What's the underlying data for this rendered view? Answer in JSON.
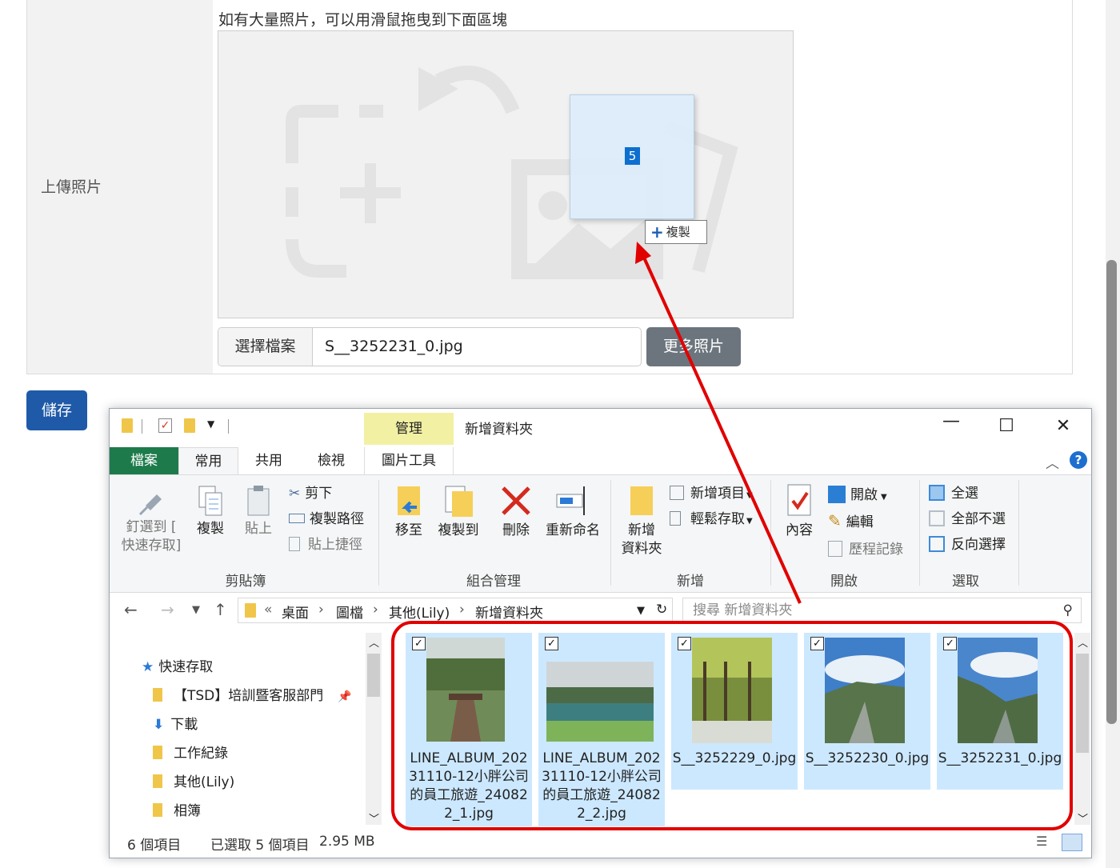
{
  "form": {
    "upload_label": "上傳照片",
    "hint": "如有大量照片，可以用滑鼠拖曳到下面區塊",
    "drag": {
      "count": "5",
      "copy_label": "複製"
    },
    "choose_button": "選擇檔案",
    "file_name": "S__3252231_0.jpg",
    "more_photos_button": "更多照片",
    "save_button": "儲存"
  },
  "explorer": {
    "window_title": "新增資料夾",
    "manage_tab": "管理",
    "tabs": [
      "檔案",
      "常用",
      "共用",
      "檢視",
      "圖片工具"
    ],
    "ribbon": {
      "clipboard": {
        "label": "剪貼簿",
        "pin": "釘選到 [快速存取]",
        "pin_line1": "釘選到 [",
        "pin_line2": "快速存取]",
        "copy": "複製",
        "paste": "貼上",
        "cut": "剪下",
        "copy_path": "複製路徑",
        "paste_shortcut": "貼上捷徑"
      },
      "organize": {
        "label": "組合管理",
        "move_to": "移至",
        "copy_to": "複製到",
        "delete": "刪除",
        "rename": "重新命名"
      },
      "new": {
        "label": "新增",
        "new_folder": "新增資料夾",
        "new_folder_line1": "新增",
        "new_folder_line2": "資料夾",
        "new_item": "新增項目",
        "easy_access": "輕鬆存取"
      },
      "open": {
        "label": "開啟",
        "properties": "內容",
        "open": "開啟",
        "edit": "編輯",
        "history": "歷程記錄"
      },
      "select": {
        "label": "選取",
        "select_all": "全選",
        "select_none": "全部不選",
        "invert": "反向選擇"
      }
    },
    "breadcrumb": {
      "prefix": "«",
      "parts": [
        "桌面",
        "圖檔",
        "其他(Lily)",
        "新增資料夾"
      ]
    },
    "search_placeholder": "搜尋 新增資料夾",
    "nav_pane": {
      "quick_access": "快速存取",
      "items": [
        "【TSD】培訓暨客服部門",
        "下載",
        "工作紀錄",
        "其他(Lily)",
        "相簿"
      ]
    },
    "files": [
      {
        "name": "LINE_ALBUM_20231110-12小胖公司的員工旅遊_240822_1.jpg"
      },
      {
        "name": "LINE_ALBUM_20231110-12小胖公司的員工旅遊_240822_2.jpg"
      },
      {
        "name": "S__3252229_0.jpg"
      },
      {
        "name": "S__3252230_0.jpg"
      },
      {
        "name": "S__3252231_0.jpg"
      }
    ],
    "status": {
      "item_count": "6 個項目",
      "selected": "已選取 5 個項目",
      "size": "2.95 MB"
    }
  },
  "colors": {
    "save_button": "#1f5aa8",
    "more_button": "#6c757d",
    "file_tab": "#1d7b4b",
    "selection": "#cce8ff",
    "annotation": "#e10000"
  }
}
